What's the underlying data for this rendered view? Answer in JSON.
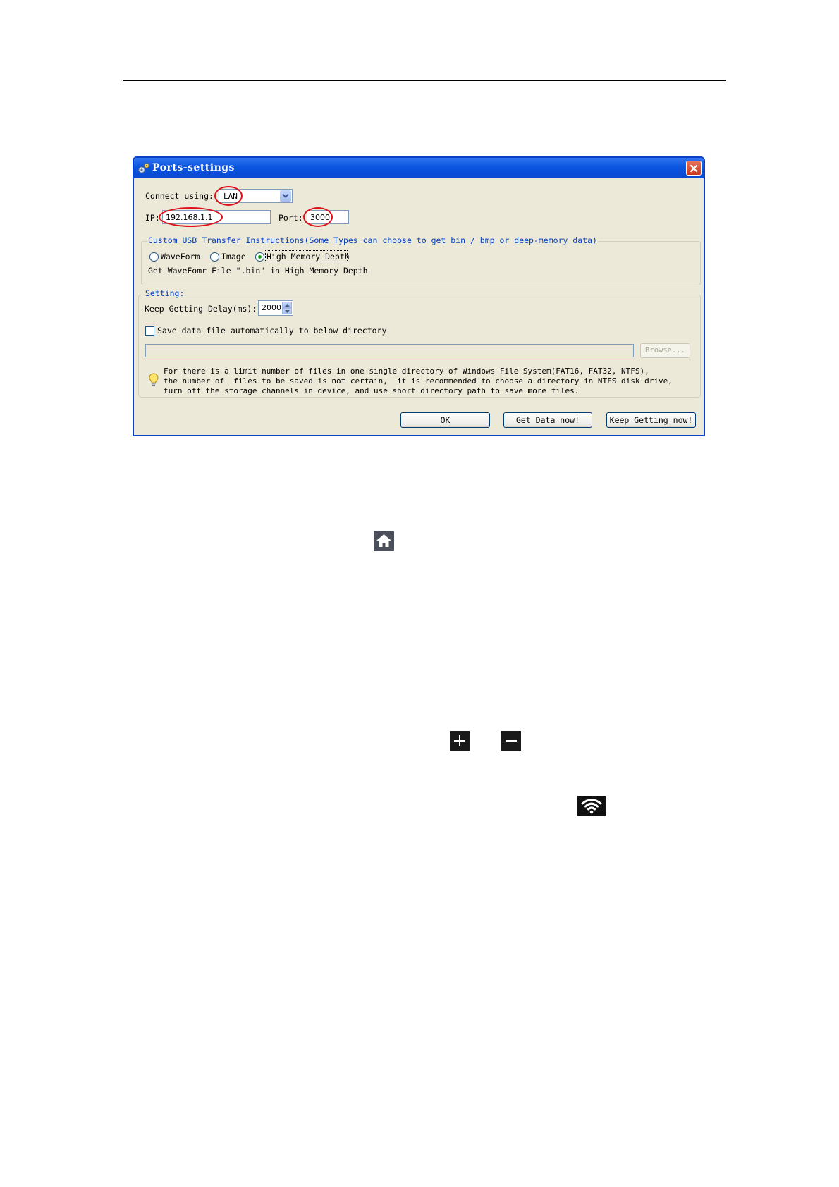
{
  "dialog": {
    "title": "Ports-settings",
    "connect_label": "Connect using:",
    "connect_value": "LAN",
    "ip_label": "IP:",
    "ip_value": "192.168.1.1",
    "port_label": "Port:",
    "port_value": "3000",
    "usb_group": {
      "legend": "Custom USB Transfer Instructions(Some Types can choose to get bin / bmp or deep-memory data)",
      "options": [
        "WaveForm",
        "Image",
        "High Memory Depth"
      ],
      "selected": "High Memory Depth",
      "description": "Get WaveFomr File \".bin\" in High Memory Depth"
    },
    "setting_group": {
      "legend": "Setting:",
      "delay_label": "Keep Getting Delay(ms):",
      "delay_value": "2000",
      "save_checkbox_label": "Save data file automatically to below directory",
      "save_checked": false,
      "browse_label": "Browse...",
      "note_lines": [
        "For there is a limit number of files in one single directory of Windows File System(FAT16, FAT32, NTFS),",
        "the number of  files to be saved is not certain,  it is recommended to choose a directory in NTFS disk drive,",
        "turn off the storage channels in device, and use short directory path to save more files."
      ]
    },
    "buttons": {
      "ok": "OK",
      "get_data": "Get Data now!",
      "keep_getting": "Keep Getting now!"
    }
  },
  "icons": [
    "home-icon",
    "plus-icon",
    "minus-icon",
    "wifi-icon"
  ],
  "colors": {
    "titlebar": "#0a55e0",
    "dialog_bg": "#ece9d8",
    "highlight_red": "#e0101a",
    "group_text": "#0040c0",
    "icon_bg": "#1a1a1a"
  }
}
